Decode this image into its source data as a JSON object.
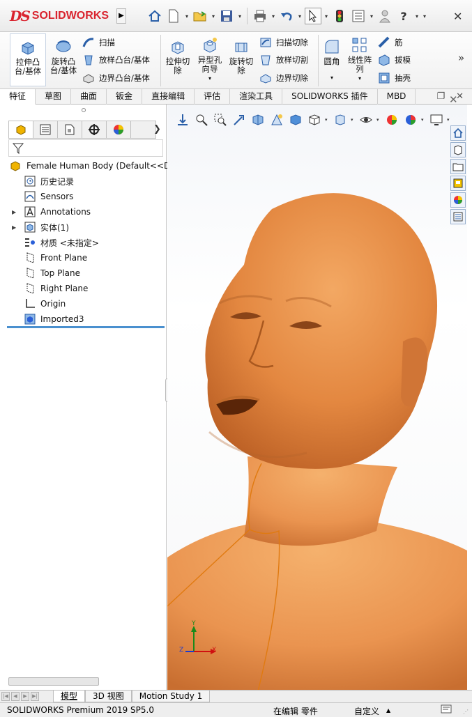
{
  "app": {
    "brand": "SOLIDWORKS",
    "brand_mark": "DS"
  },
  "titlebar": {
    "icons": [
      "home-icon",
      "new-document-icon",
      "open-icon",
      "save-icon",
      "print-icon",
      "undo-icon",
      "select-icon",
      "rebuild-icon",
      "file-properties-icon",
      "user-icon",
      "help-icon"
    ],
    "help_label": "?",
    "close_label": "✕"
  },
  "ribbon": {
    "extrude_boss": "拉伸凸\n台/基体",
    "revolve_boss": "旋转凸\n台/基体",
    "sweep": "扫描",
    "loft_boss": "放样凸台/基体",
    "boundary_boss": "边界凸台/基体",
    "extrude_cut": "拉伸切\n除",
    "hole_wizard": "异型孔\n向导",
    "revolve_cut": "旋转切\n除",
    "swept_cut": "扫描切除",
    "lofted_cut": "放样切割",
    "boundary_cut": "边界切除",
    "fillet": "圆角",
    "linear_pattern": "线性阵\n列",
    "rib": "筋",
    "draft": "拔模",
    "shell": "抽壳",
    "more": "»"
  },
  "command_tabs": [
    "特征",
    "草图",
    "曲面",
    "钣金",
    "直接编辑",
    "评估",
    "渲染工具",
    "SOLIDWORKS 插件",
    "MBD"
  ],
  "window_controls": {
    "restore": "❐",
    "close": "✕"
  },
  "feature_tree": {
    "root": "Female Human Body  (Default<<D",
    "items": [
      {
        "label": "历史记录",
        "icon": "history-icon",
        "expandable": false
      },
      {
        "label": "Sensors",
        "icon": "sensors-icon",
        "expandable": false
      },
      {
        "label": "Annotations",
        "icon": "annotations-icon",
        "expandable": true
      },
      {
        "label": "实体(1)",
        "icon": "solid-bodies-icon",
        "expandable": true
      },
      {
        "label": "材质 <未指定>",
        "icon": "material-icon",
        "expandable": false
      },
      {
        "label": "Front Plane",
        "icon": "plane-icon",
        "expandable": false
      },
      {
        "label": "Top Plane",
        "icon": "plane-icon",
        "expandable": false
      },
      {
        "label": "Right Plane",
        "icon": "plane-icon",
        "expandable": false
      },
      {
        "label": "Origin",
        "icon": "origin-icon",
        "expandable": false
      },
      {
        "label": "Imported3",
        "icon": "imported-body-icon",
        "expandable": false
      }
    ]
  },
  "bottom_tabs": [
    "模型",
    "3D 视图",
    "Motion Study 1"
  ],
  "statusbar": {
    "product": "SOLIDWORKS Premium 2019 SP5.0",
    "editing": "在编辑 零件",
    "custom": "自定义"
  },
  "triad": {
    "x": "X",
    "y": "Y",
    "z": "Z"
  },
  "colors": {
    "brand_red": "#d9232e",
    "model_orange": "#e8893f",
    "tree_accent": "#4a90cf",
    "sketch_line": "#e07a10"
  }
}
